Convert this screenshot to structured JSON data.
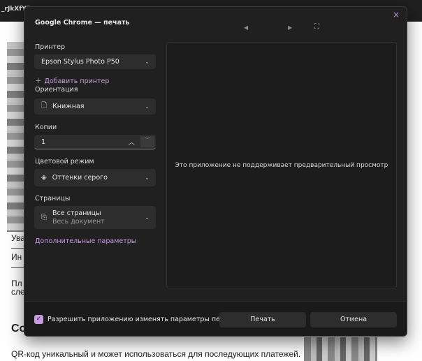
{
  "background": {
    "tab_title": "_rJkXfYR",
    "lines": [
      "Ува",
      "Ин",
      "Пл",
      "сле",
      "Со"
    ],
    "qr_text": "QR-код уникальный и может использоваться для последующих платежей."
  },
  "dialog": {
    "title": "Google Chrome — печать",
    "close_icon": "×",
    "printer": {
      "label": "Принтер",
      "value": "Epson Stylus Photo P50",
      "add": "Добавить принтер"
    },
    "orientation": {
      "label": "Ориентация",
      "value": "Книжная"
    },
    "copies": {
      "label": "Копии",
      "value": "1"
    },
    "color": {
      "label": "Цветовой режим",
      "value": "Оттенки серого"
    },
    "pages": {
      "label": "Страницы",
      "value": "Все страницы",
      "sub": "Весь документ"
    },
    "more": "Дополнительные параметры",
    "preview_message": "Это приложение не поддерживает предварительный просмотр",
    "allow": {
      "label": "Разрешить приложению изменять параметры печати",
      "checked": true
    },
    "print": "Печать",
    "cancel": "Отмена",
    "accent": "#c89be0"
  }
}
